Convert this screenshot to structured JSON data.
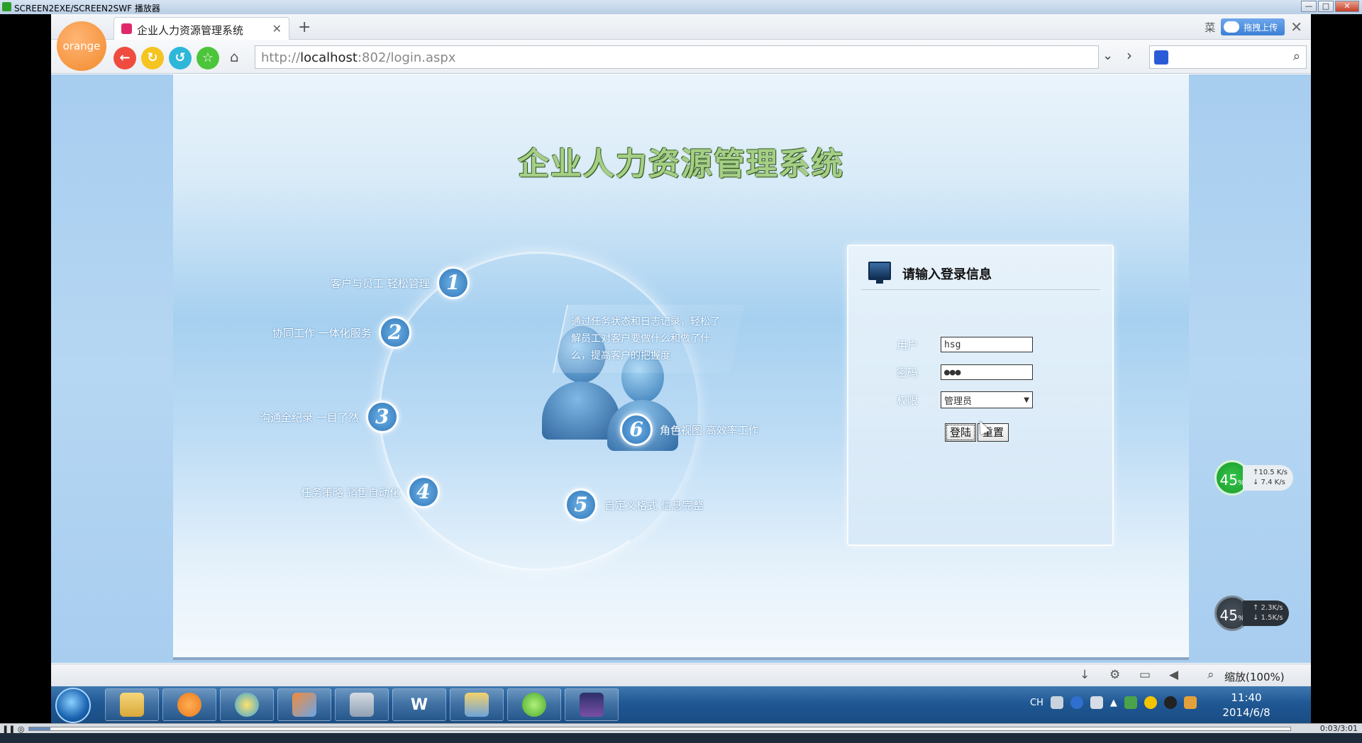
{
  "player": {
    "title": "SCREEN2EXE/SCREEN2SWF 播放器",
    "time": "0:03/3:01",
    "progress_fraction": 0.017
  },
  "browser": {
    "logo_text": "orange",
    "tab_title": "企业人力资源管理系统",
    "tab_close": "✕",
    "new_tab": "+",
    "menu_text": "菜",
    "upload_label": "拖拽上传",
    "close_x": "✕",
    "address_prefix": "http://",
    "address_host": "localhost",
    "address_rest": ":802/login.aspx",
    "icons": [
      "back-icon",
      "refresh-icon",
      "undo-icon",
      "favorite-icon",
      "home-icon",
      "dropdown-icon",
      "go-icon",
      "baidu-icon",
      "search-icon"
    ]
  },
  "page": {
    "system_title": "企业人力资源管理系统",
    "features": [
      {
        "num": "1",
        "text": "客户与员工  轻松管理"
      },
      {
        "num": "2",
        "text": "协同工作  一体化服务"
      },
      {
        "num": "3",
        "text": "沟通全纪录  一目了然"
      },
      {
        "num": "4",
        "text": "任务策略  销售自动化"
      },
      {
        "num": "5",
        "text": "自定义格式  信息完整"
      },
      {
        "num": "6",
        "text": "角色视图  高效率工作"
      }
    ],
    "description": "通过任务状态和日志记录，轻松了解员工对客户要做什么和做了什么，提高客户的把握度"
  },
  "login": {
    "title": "请输入登录信息",
    "user_label": "用户",
    "user_value": "hsg",
    "password_label": "密码",
    "password_value": "●●●",
    "role_label": "权限",
    "role_value": "管理员",
    "login_button": "登陆",
    "reset_button": "重置"
  },
  "speed_widgets": [
    {
      "percent": "45",
      "unit": "%",
      "up": "↑10.5 K/s",
      "down": "↓ 7.4 K/s"
    },
    {
      "percent": "45",
      "unit": "%",
      "up": "↑ 2.3K/s",
      "down": "↓ 1.5K/s"
    }
  ],
  "status": {
    "zoom": "缩放(100%)"
  },
  "taskbar": {
    "lang": "CH",
    "time": "11:40",
    "date": "2014/6/8",
    "word_label": "W"
  }
}
